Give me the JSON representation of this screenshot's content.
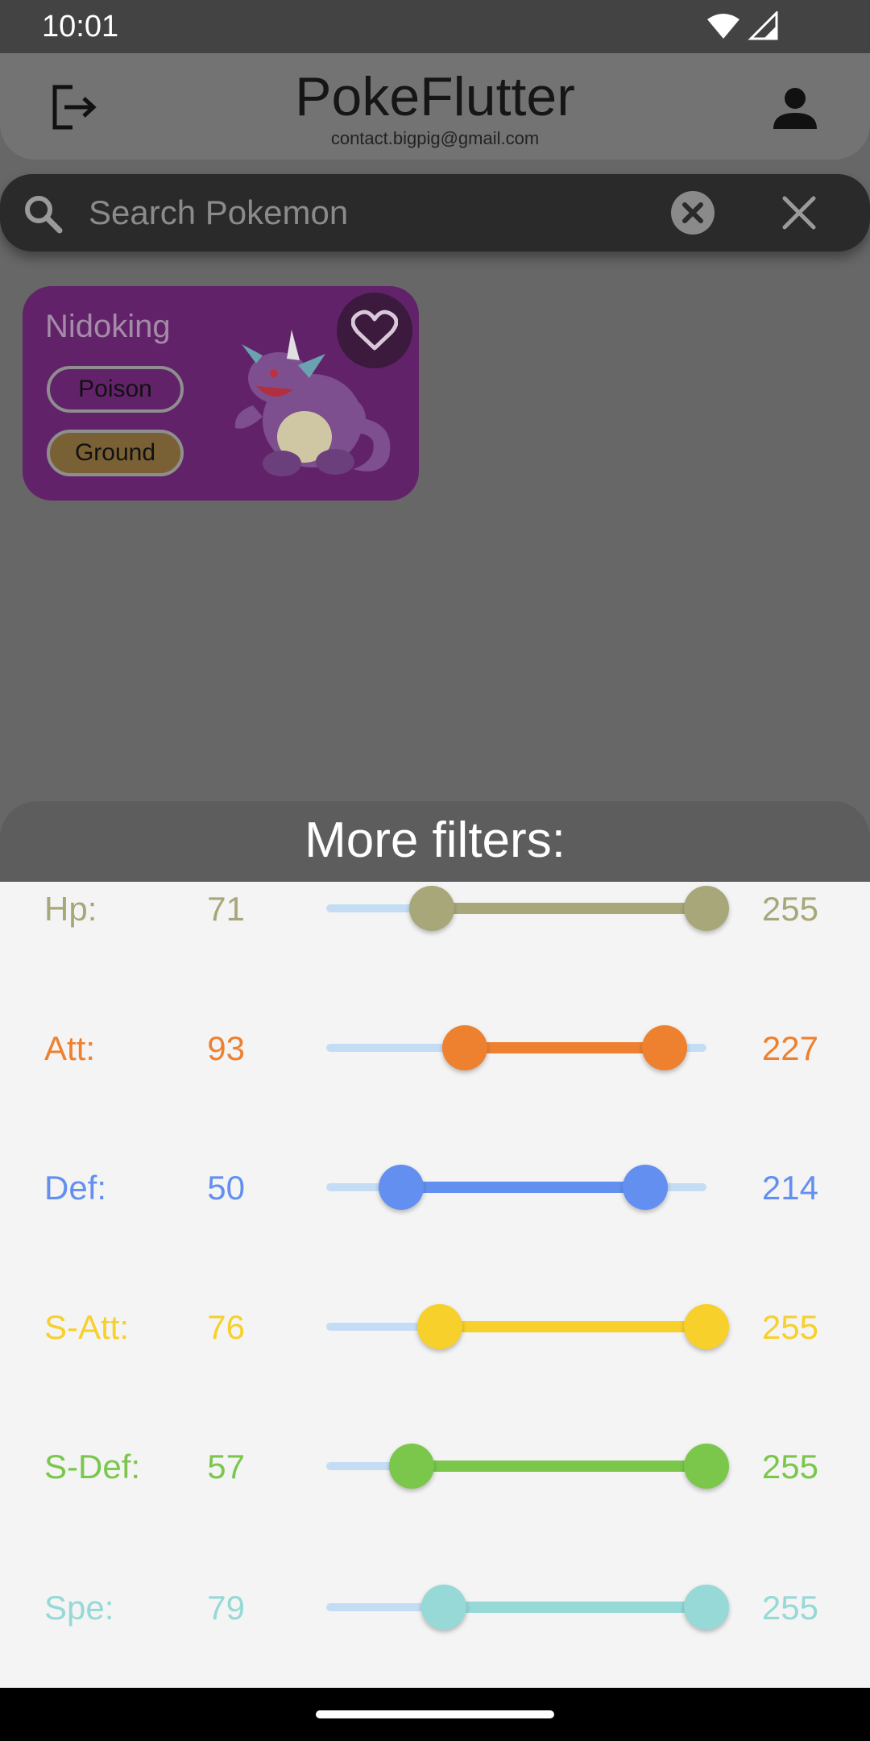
{
  "status_bar": {
    "time": "10:01"
  },
  "app_bar": {
    "title": "PokeFlutter",
    "subtitle": "contact.bigpig@gmail.com"
  },
  "search": {
    "placeholder": "Search Pokemon",
    "value": ""
  },
  "pokemon_card": {
    "name": "Nidoking",
    "types": [
      "Poison",
      "Ground"
    ],
    "type_colors": {
      "Poison": "#62226a",
      "Ground": "#7a6035"
    },
    "card_color": "#62226a",
    "favorite": false
  },
  "filters": {
    "title": "More filters:",
    "range_min": 0,
    "range_max": 255,
    "rows": [
      {
        "label": "Hp:",
        "min": "71",
        "max": "255",
        "color": "#a8a77a"
      },
      {
        "label": "Att:",
        "min": "93",
        "max": "227",
        "color": "#ee8130"
      },
      {
        "label": "Def:",
        "min": "50",
        "max": "214",
        "color": "#6390f0"
      },
      {
        "label": "S-Att:",
        "min": "76",
        "max": "255",
        "color": "#f7d02c"
      },
      {
        "label": "S-Def:",
        "min": "57",
        "max": "255",
        "color": "#7ac74c"
      },
      {
        "label": "Spe:",
        "min": "79",
        "max": "255",
        "color": "#96d9d6"
      }
    ]
  }
}
